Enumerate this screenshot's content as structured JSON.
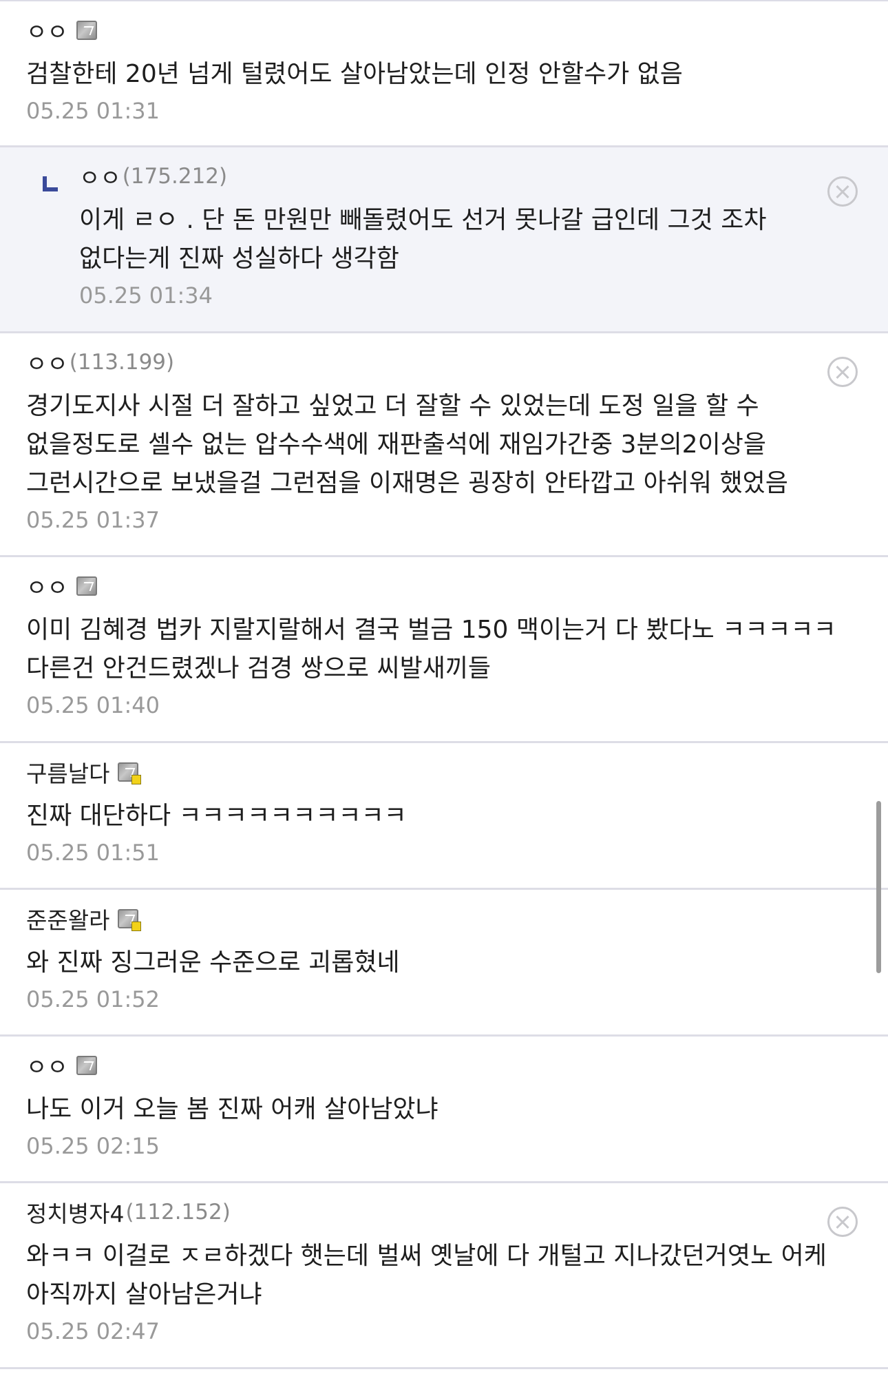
{
  "comments": [
    {
      "nick": "ㅇㅇ",
      "ip": "",
      "badge": "gallery-badge-gray",
      "text": "검찰한테 20년 넘게 털렸어도 살아남았는데 인정 안할수가 없음",
      "time": "05.25 01:31"
    },
    {
      "nick": "ㅇㅇ",
      "ip": "(175.212)",
      "badge": "",
      "text": "이게 ㄹㅇ . 단 돈 만원만 빼돌렸어도 선거 못나갈 급인데 그것 조차 없다는게 진짜 성실하다 생각함",
      "time": "05.25 01:34",
      "reply": true
    },
    {
      "nick": "ㅇㅇ",
      "ip": "(113.199)",
      "badge": "",
      "text": "경기도지사 시절 더 잘하고 싶었고 더 잘할 수 있었는데 도정 일을 할 수 없을정도로 셀수 없는 압수수색에 재판출석에 재임가간중 3분의2이상을 그런시간으로 보냈을걸 그런점을 이재명은 굉장히 안타깝고 아쉬워 했었음",
      "time": "05.25 01:37"
    },
    {
      "nick": "ㅇㅇ",
      "ip": "",
      "badge": "gallery-badge-gray",
      "text": "이미 김혜경 법카 지랄지랄해서 결국 벌금 150 맥이는거 다 봤다노 ㅋㅋㅋㅋㅋ 다른건 안건드렸겠나 검경 쌍으로 씨발새끼들",
      "time": "05.25 01:40"
    },
    {
      "nick": "구름날다",
      "ip": "",
      "badge": "gallery-badge-gold",
      "text": "진짜 대단하다 ㅋㅋㅋㅋㅋㅋㅋㅋㅋㅋ",
      "time": "05.25 01:51"
    },
    {
      "nick": "준준왈라",
      "ip": "",
      "badge": "gallery-badge-gold",
      "text": "와 진짜 징그러운 수준으로 괴롭혔네",
      "time": "05.25 01:52"
    },
    {
      "nick": "ㅇㅇ",
      "ip": "",
      "badge": "gallery-badge-gray",
      "text": "나도 이거 오늘 봄 진짜 어캐 살아남았냐",
      "time": "05.25 02:15"
    },
    {
      "nick": "정치병자4",
      "ip": "(112.152)",
      "badge": "",
      "text": "와ㅋㅋ 이걸로 ㅈㄹ하겠다 햇는데 벌써 옛날에 다 개털고 지나갔던거엿노 어케 아직까지 살아남은거냐",
      "time": "05.25 02:47"
    }
  ],
  "delete_icon": "close-circle-icon",
  "reply_icon": "reply-arrow-icon"
}
